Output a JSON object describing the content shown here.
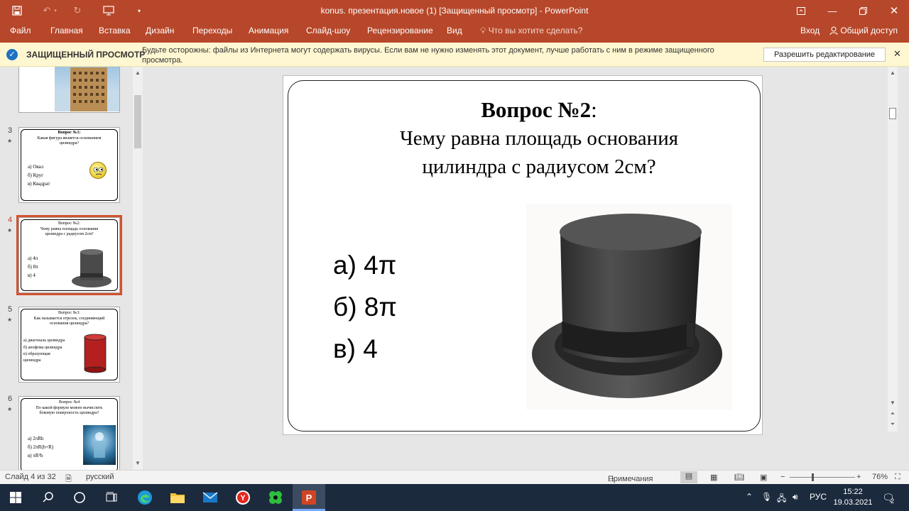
{
  "window": {
    "title": "konus. презентация.новое (1)  [Защищенный просмотр]  -  PowerPoint"
  },
  "ribbon": {
    "tabs": [
      "Файл",
      "Главная",
      "Вставка",
      "Дизайн",
      "Переходы",
      "Анимация",
      "Слайд-шоу",
      "Рецензирование",
      "Вид"
    ],
    "tell_me": "Что вы хотите сделать?",
    "sign_in": "Вход",
    "share": "Общий доступ"
  },
  "protected_view": {
    "label": "ЗАЩИЩЕННЫЙ ПРОСМОТР",
    "message": "Будьте осторожны: файлы из Интернета могут содержать вирусы. Если вам не нужно изменять этот документ, лучше работать с ним в режиме защищенного просмотра.",
    "button": "Разрешить редактирование"
  },
  "thumbnails": [
    {
      "number": "3",
      "title": "Вопрос №1:",
      "question": "Какая фигура является основанием цилиндра?",
      "answers": [
        "а) Овал",
        "б) Круг",
        "в) Квадрат"
      ]
    },
    {
      "number": "4",
      "title": "Вопрос №2:",
      "question": "Чему равна площадь основания цилиндра с радиусом 2см?",
      "answers": [
        "а) 4π",
        "б) 8π",
        "в) 4"
      ]
    },
    {
      "number": "5",
      "title": "Вопрос №3:",
      "question": "Как называется отрезок, соединяющий основания цилиндра?",
      "answers": [
        "а) диагональ цилиндра",
        "б) апофема цилиндра",
        "в) образующая цилиндра"
      ]
    },
    {
      "number": "6",
      "title": "Вопрос №4",
      "question": "По какой формуле можно вычислить боковую поверхность цилиндра?",
      "answers": [
        "а) 2πRh",
        "б) 2πR(h+R)",
        "в) πR²h"
      ]
    }
  ],
  "slide": {
    "title_bold": "Вопрос №2",
    "title_colon": ":",
    "question_line1": "Чему равна площадь основания",
    "question_line2": "цилиндра с радиусом 2см?",
    "answers": [
      "а) 4π",
      "б) 8π",
      "в) 4"
    ]
  },
  "status": {
    "slide_counter": "Слайд 4 из 32",
    "language": "русский",
    "notes": "Примечания",
    "zoom": "76%"
  },
  "taskbar": {
    "language": "РУС",
    "time": "15:22",
    "date": "19.03.2021",
    "notification_count": "2"
  },
  "colors": {
    "accent": "#b7472a",
    "selection": "#d35230",
    "taskbar": "#1c2a3e",
    "infobar": "#fff7d1"
  }
}
